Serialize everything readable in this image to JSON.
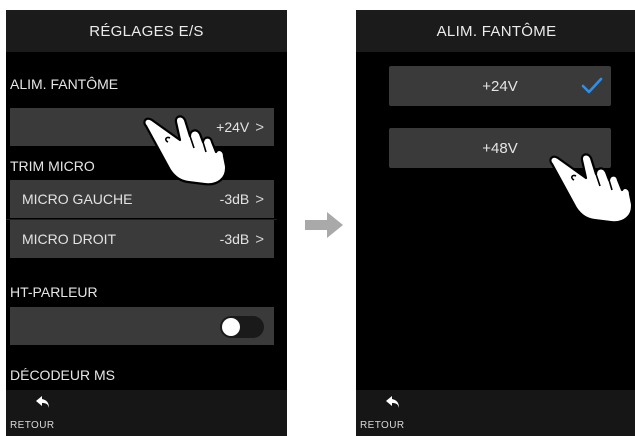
{
  "left": {
    "title": "RÉGLAGES E/S",
    "phantom_label": "ALIM. FANTÔME",
    "phantom_value": "+24V",
    "trim_label": "TRIM MICRO",
    "mic_left_label": "MICRO GAUCHE",
    "mic_left_value": "-3dB",
    "mic_right_label": "MICRO DROIT",
    "mic_right_value": "-3dB",
    "speaker_label": "HT-PARLEUR",
    "speaker_on": false,
    "ms_label": "DÉCODEUR MS",
    "back_label": "RETOUR"
  },
  "right": {
    "title": "ALIM. FANTÔME",
    "options": [
      {
        "label": "+24V",
        "selected": true
      },
      {
        "label": "+48V",
        "selected": false
      }
    ],
    "back_label": "RETOUR"
  },
  "colors": {
    "screen_bg": "#000000",
    "row_bg": "#3a3a3a",
    "check": "#2f8fe8"
  },
  "chevron": ">"
}
